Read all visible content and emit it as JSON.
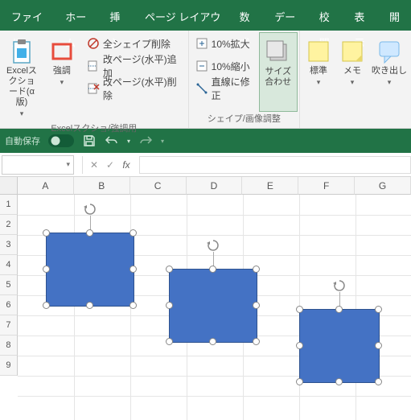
{
  "tabs": {
    "file": "ファイル",
    "home": "ホーム",
    "insert": "挿入",
    "layout": "ページ レイアウト",
    "formula": "数式",
    "data": "データ",
    "review": "校閲",
    "view": "表示",
    "dev": "開"
  },
  "ribbon": {
    "group1": {
      "btn1": "Excelスクショ\nード(α版)",
      "btn2": "強調",
      "label": "Excelスクショ/強調用",
      "row1": "全シェイプ削除",
      "row2": "改ページ(水平)追加",
      "row3": "改ページ(水平)削除"
    },
    "group2": {
      "row1": "10%拡大",
      "row2": "10%縮小",
      "row3": "直線に修正",
      "btn": "サイズ\n合わせ",
      "label": "シェイプ/画像調整"
    },
    "group3": {
      "btn1": "標準",
      "btn2": "メモ",
      "btn3": "吹き出し"
    }
  },
  "qat": {
    "autosave": "自動保存"
  },
  "namebox": {
    "value": ""
  },
  "columns": [
    "A",
    "B",
    "C",
    "D",
    "E",
    "F",
    "G"
  ],
  "rows": [
    "1",
    "2",
    "3",
    "4",
    "5",
    "6",
    "7",
    "8",
    "9"
  ],
  "chart_data": null
}
